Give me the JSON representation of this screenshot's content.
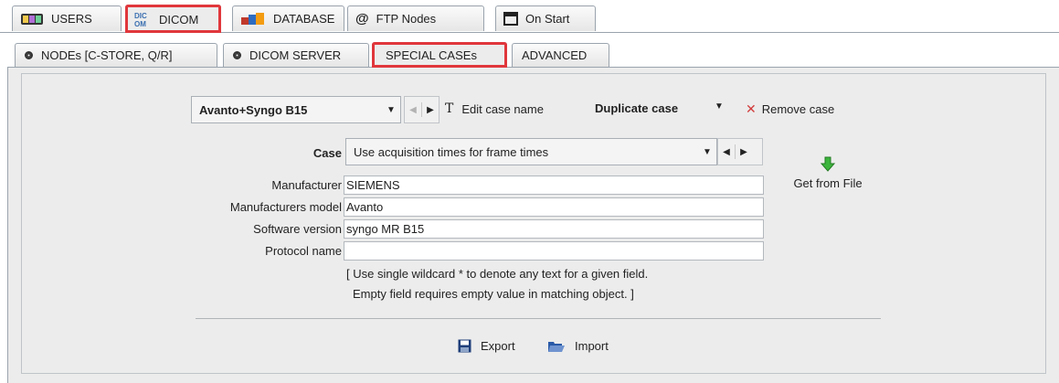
{
  "top_tabs": [
    {
      "label": "USERS",
      "icon": "users-icon"
    },
    {
      "label": "DICOM",
      "icon": "dicom-icon"
    },
    {
      "label": "DATABASE",
      "icon": "database-icon"
    },
    {
      "label": "FTP Nodes",
      "icon": "at-icon"
    },
    {
      "label": "On Start",
      "icon": "window-icon"
    }
  ],
  "sub_tabs": [
    {
      "label": "NODEs [C-STORE, Q/R]"
    },
    {
      "label": "DICOM SERVER"
    },
    {
      "label": "SPECIAL CASEs"
    },
    {
      "label": "ADVANCED"
    }
  ],
  "case_toolbar": {
    "selected_case": "Avanto+Syngo B15",
    "edit_label": "Edit case name",
    "duplicate_label": "Duplicate case",
    "remove_label": "Remove case"
  },
  "form": {
    "case_label": "Case",
    "case_value": "Use acquisition times for frame times",
    "manufacturer_label": "Manufacturer",
    "manufacturer_value": "SIEMENS",
    "model_label": "Manufacturers model",
    "model_value": "Avanto",
    "software_label": "Software version",
    "software_value": "syngo MR B15",
    "protocol_label": "Protocol name",
    "protocol_value": "",
    "get_from_file_label": "Get from File",
    "hint_line1": "[ Use single wildcard * to denote any text for a given field.",
    "hint_line2": "Empty field requires empty value in matching object. ]"
  },
  "bottom": {
    "export_label": "Export",
    "import_label": "Import"
  },
  "colors": {
    "highlight": "#e0373c",
    "remove_x": "#d23b3b",
    "green_arrow": "#3cb53c"
  }
}
